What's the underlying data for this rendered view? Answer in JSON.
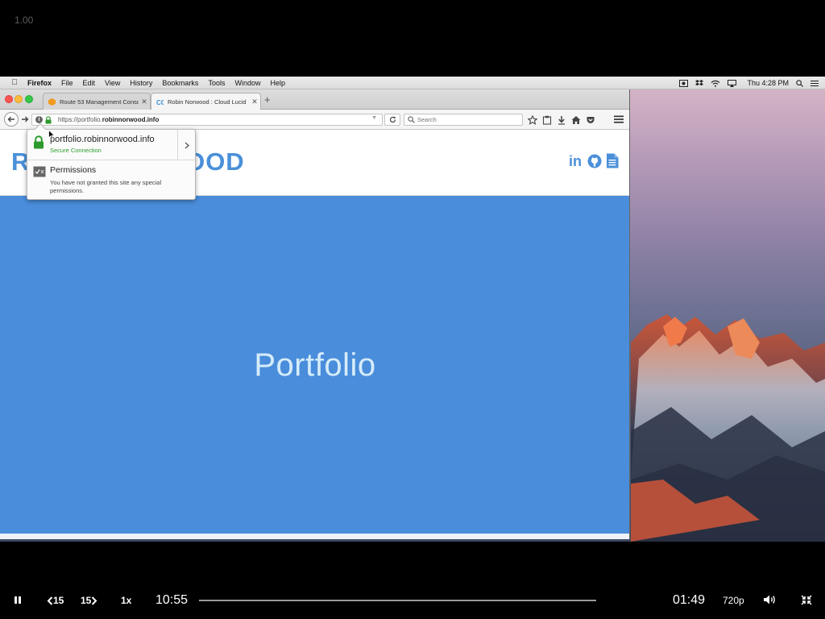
{
  "player": {
    "zoom_readout": "1.00",
    "elapsed": "10:55",
    "remaining": "01:49",
    "rewind_label": "15",
    "forward_label": "15",
    "speed": "1x",
    "quality": "720p",
    "progress_fraction": 0.0
  },
  "menubar": {
    "items": [
      "Firefox",
      "File",
      "Edit",
      "View",
      "History",
      "Bookmarks",
      "Tools",
      "Window",
      "Help"
    ],
    "clock": "Thu 4:28 PM"
  },
  "browser": {
    "tabs": [
      {
        "label": "Route 53 Management Conso",
        "favicon": "aws-cube-icon",
        "active": false
      },
      {
        "label": "Robin Norwood : Cloud Lucid",
        "favicon": "cg-logo-icon",
        "active": true
      }
    ],
    "url_prefix": "https://portfolio.",
    "url_domain": "robinnorwood.info",
    "search_placeholder": "Search"
  },
  "popup": {
    "host": "portfolio.robinnorwood.info",
    "secure_text": "Secure Connection",
    "permissions_title": "Permissions",
    "permissions_desc": "You have not granted this site any special permissions."
  },
  "site": {
    "logo": "ROBIN NORWOOD",
    "hero_title": "Portfolio",
    "social_icons": [
      "linkedin-icon",
      "github-icon",
      "document-icon"
    ]
  },
  "colors": {
    "accent": "#4a90d9",
    "hero_bg": "#4a8ddb",
    "secure_green": "#2c9a2c"
  }
}
